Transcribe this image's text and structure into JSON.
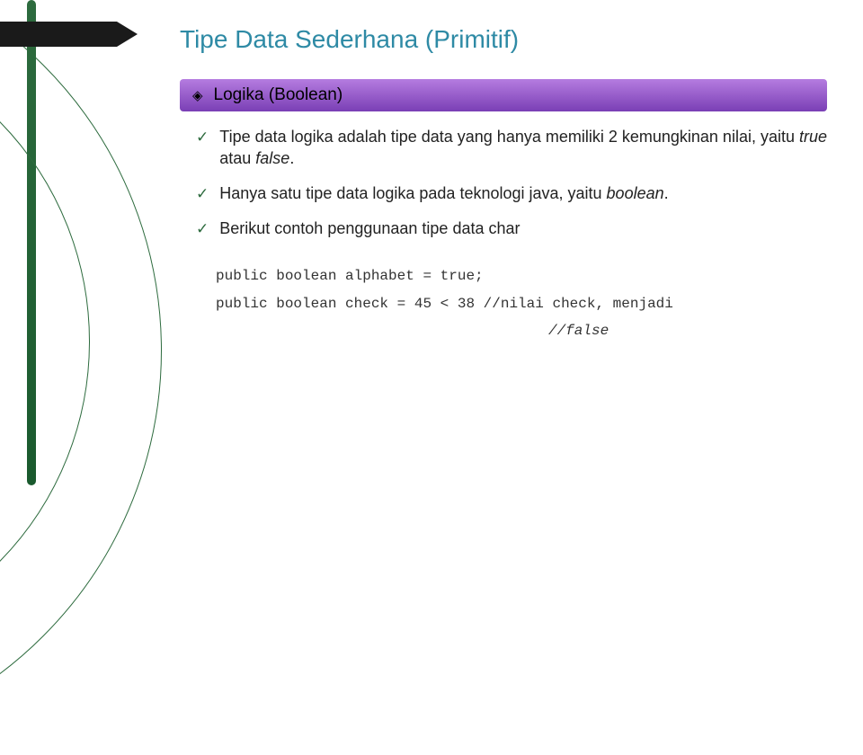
{
  "title": "Tipe Data Sederhana (Primitif)",
  "banner": {
    "label": "Logika (Boolean)"
  },
  "bullets": [
    {
      "pre": "Tipe data logika adalah tipe data yang hanya memiliki 2 kemungkinan nilai, yaitu ",
      "em1": "true",
      "mid": " atau ",
      "em2": "false",
      "post": "."
    },
    {
      "pre": "Hanya satu tipe data logika pada teknologi java, yaitu ",
      "em1": "boolean",
      "mid": "",
      "em2": "",
      "post": "."
    },
    {
      "pre": "Berikut contoh penggunaan tipe data char",
      "em1": "",
      "mid": "",
      "em2": "",
      "post": ""
    }
  ],
  "code": {
    "line1": "public boolean alphabet = true;",
    "line2": "public boolean check = 45 < 38 //nilai check, menjadi",
    "line3": "//false"
  }
}
